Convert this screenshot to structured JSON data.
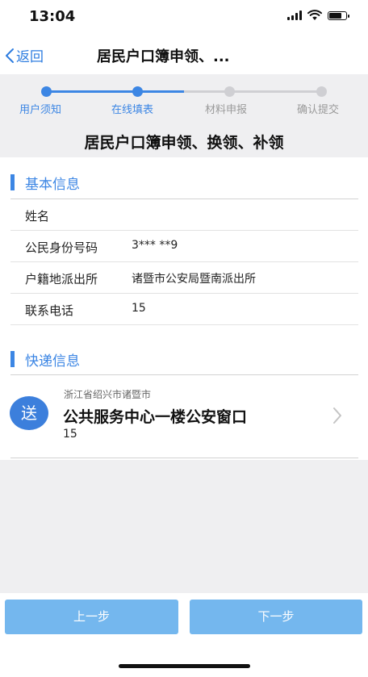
{
  "status_bar": {
    "time": "13:04"
  },
  "nav": {
    "back_label": "返回",
    "title": "居民户口簿申领、..."
  },
  "steps": [
    {
      "label": "用户须知",
      "state": "done"
    },
    {
      "label": "在线填表",
      "state": "active"
    },
    {
      "label": "材料申报",
      "state": "pending"
    },
    {
      "label": "确认提交",
      "state": "pending"
    }
  ],
  "form_title": "居民户口簿申领、换领、补领",
  "basic_info": {
    "title": "基本信息",
    "rows": [
      {
        "label": "姓名",
        "value": ""
      },
      {
        "label": "公民身份号码",
        "value": "3*** **9"
      },
      {
        "label": "户籍地派出所",
        "value": "诸暨市公安局暨南派出所"
      },
      {
        "label": "联系电话",
        "value": "15"
      }
    ]
  },
  "express_info": {
    "title": "快递信息",
    "badge": "送",
    "region": "浙江省绍兴市诸暨市",
    "place": "公共服务中心一楼公安窗口",
    "contact": "15"
  },
  "footer": {
    "prev_label": "上一步",
    "next_label": "下一步"
  },
  "colors": {
    "accent": "#3c86e4",
    "button": "#74b7ee",
    "step_pending": "#cfcfd3",
    "background": "#efeff1"
  }
}
